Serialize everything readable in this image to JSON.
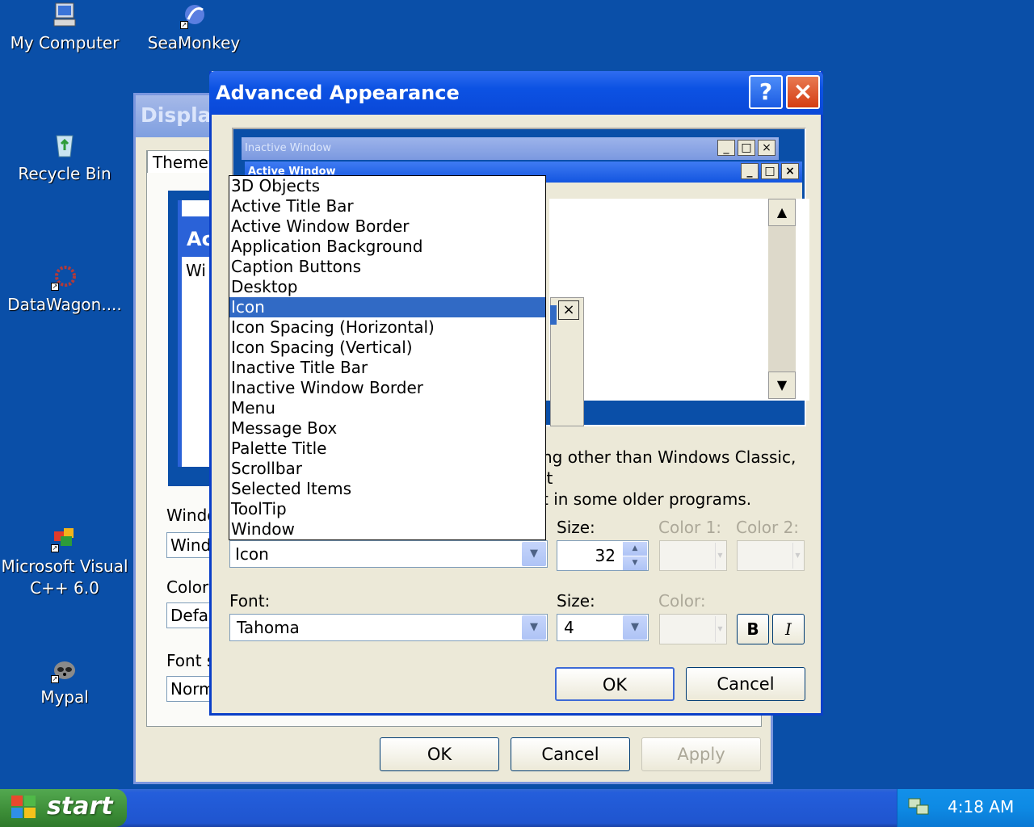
{
  "desktop": {
    "icons": [
      {
        "label": "My Computer",
        "icon": "my-computer-icon"
      },
      {
        "label": "SeaMonkey",
        "icon": "seamonkey-icon"
      },
      {
        "label": "Recycle Bin",
        "icon": "recycle-bin-icon"
      },
      {
        "label": "DataWagon....",
        "icon": "datawagon-icon"
      },
      {
        "label": "Microsoft Visual C++ 6.0",
        "icon": "visual-cpp-icon"
      },
      {
        "label": "Mypal",
        "icon": "mypal-icon"
      }
    ]
  },
  "display_dialog": {
    "title": "Display",
    "tab": "Themes",
    "preview_title": "Ac",
    "preview_text": "Wi",
    "labels": {
      "windows": "Windo",
      "color": "Color",
      "font": "Font s"
    },
    "combos": {
      "windows": "Wind",
      "color": "Defau",
      "font": "Norm"
    },
    "buttons": {
      "ok": "OK",
      "cancel": "Cancel",
      "apply": "Apply"
    }
  },
  "advanced_dialog": {
    "title": "Advanced Appearance",
    "help": "?",
    "close": "×",
    "preview": {
      "inactive_title": "Inactive Window",
      "active_title": "Active Window"
    },
    "description_line1": "ng other than Windows Classic, it",
    "description_line2": "t in some older programs.",
    "item_selected": "Icon",
    "size_label": "Size:",
    "size_value": "32",
    "color1_label": "Color 1:",
    "color2_label": "Color 2:",
    "font_label": "Font:",
    "font_value": "Tahoma",
    "font_size_label": "Size:",
    "font_size_value": "4",
    "font_color_label": "Color:",
    "bold": "B",
    "italic": "I",
    "ok": "OK",
    "cancel": "Cancel"
  },
  "item_list": {
    "items": [
      "3D Objects",
      "Active Title Bar",
      "Active Window Border",
      "Application Background",
      "Caption Buttons",
      "Desktop",
      "Icon",
      "Icon Spacing (Horizontal)",
      "Icon Spacing (Vertical)",
      "Inactive Title Bar",
      "Inactive Window Border",
      "Menu",
      "Message Box",
      "Palette Title",
      "Scrollbar",
      "Selected Items",
      "ToolTip",
      "Window"
    ],
    "selected_index": 6
  },
  "taskbar": {
    "start": "start",
    "clock": "4:18 AM"
  },
  "colors": {
    "desktop": "#0a4fa8",
    "title_active": "#0c52e3",
    "selection": "#316ac5",
    "dialog_face": "#ece9d8"
  }
}
